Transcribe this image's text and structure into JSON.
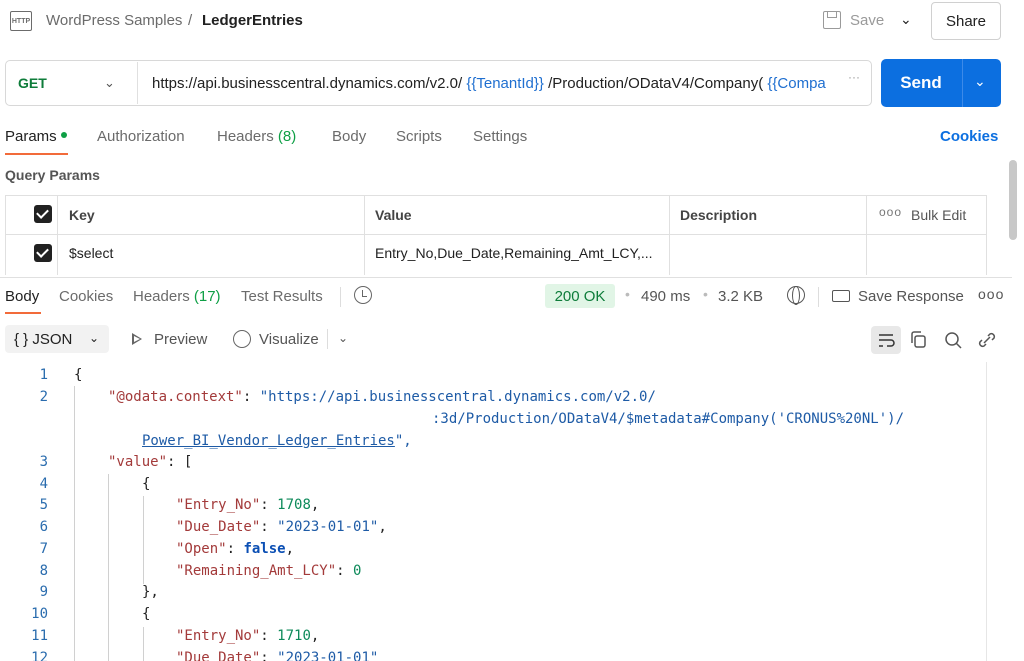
{
  "header": {
    "icon": "http-icon",
    "icon_text": "HTTP",
    "workspace": "WordPress Samples",
    "separator": "/",
    "request_name": "LedgerEntries",
    "save_label": "Save",
    "share_label": "Share"
  },
  "request": {
    "method": "GET",
    "url_part1": "https://api.businesscentral.dynamics.com/v2.0/",
    "url_var1": "{{TenantId}}",
    "url_part2": "/Production/ODataV4/Company(",
    "url_var2": "{{Compa",
    "url_more": "···",
    "send_label": "Send"
  },
  "request_tabs": [
    {
      "label": "Params"
    },
    {
      "label": "Authorization"
    },
    {
      "label": "Headers",
      "count": "(8)"
    },
    {
      "label": "Body"
    },
    {
      "label": "Scripts"
    },
    {
      "label": "Settings"
    }
  ],
  "cookies_link": "Cookies",
  "query_params": {
    "title": "Query Params",
    "headers": {
      "key": "Key",
      "value": "Value",
      "description": "Description",
      "bulk_edit": "Bulk Edit",
      "more": "ooo"
    },
    "rows": [
      {
        "checked": true,
        "key": "$select",
        "value": "Entry_No,Due_Date,Remaining_Amt_LCY,...",
        "description": ""
      }
    ]
  },
  "response_tabs": [
    {
      "label": "Body"
    },
    {
      "label": "Cookies"
    },
    {
      "label": "Headers",
      "count": "(17)"
    },
    {
      "label": "Test Results"
    }
  ],
  "response_meta": {
    "status": "200 OK",
    "time": "490 ms",
    "size": "3.2 KB",
    "save_response": "Save Response",
    "more": "ooo",
    "dot": "•"
  },
  "viewer": {
    "format_icon": "{ }",
    "format": "JSON",
    "preview": "Preview",
    "visualize": "Visualize"
  },
  "code_lines": [
    {
      "n": "1"
    },
    {
      "n": "2"
    },
    {
      "n": ""
    },
    {
      "n": ""
    },
    {
      "n": "3"
    },
    {
      "n": "4"
    },
    {
      "n": "5"
    },
    {
      "n": "6"
    },
    {
      "n": "7"
    },
    {
      "n": "8"
    },
    {
      "n": "9"
    },
    {
      "n": "10"
    },
    {
      "n": "11"
    },
    {
      "n": "12"
    }
  ],
  "code": {
    "brace_open": "{",
    "key_context": "\"@odata.context\"",
    "colon": ": ",
    "ctx1": "\"https://api.businesscentral.dynamics.com/v2.0/",
    "ctx2": ":3d/Production/ODataV4/$metadata#Company('CRONUS%20NL')/",
    "ctx3": "Power_BI_Vendor_Ledger_Entries",
    "ctx3_end": "\",",
    "key_value": "\"value\"",
    "bracket_open": "[",
    "obj_open": "{",
    "key_entry": "\"Entry_No\"",
    "entry1": "1708",
    "comma": ",",
    "key_due": "\"Due_Date\"",
    "due1": "\"2023-01-01\"",
    "key_open": "\"Open\"",
    "open1": "false",
    "key_rem": "\"Remaining_Amt_LCY\"",
    "rem1": "0",
    "obj_close": "},",
    "entry2": "1710",
    "due2": "\"2023-01-01\""
  },
  "colors": {
    "accent": "#f26b3a",
    "send": "#0c6fe0",
    "status_ok": "#0e7c3a",
    "method_get": "#0e7c3a"
  }
}
